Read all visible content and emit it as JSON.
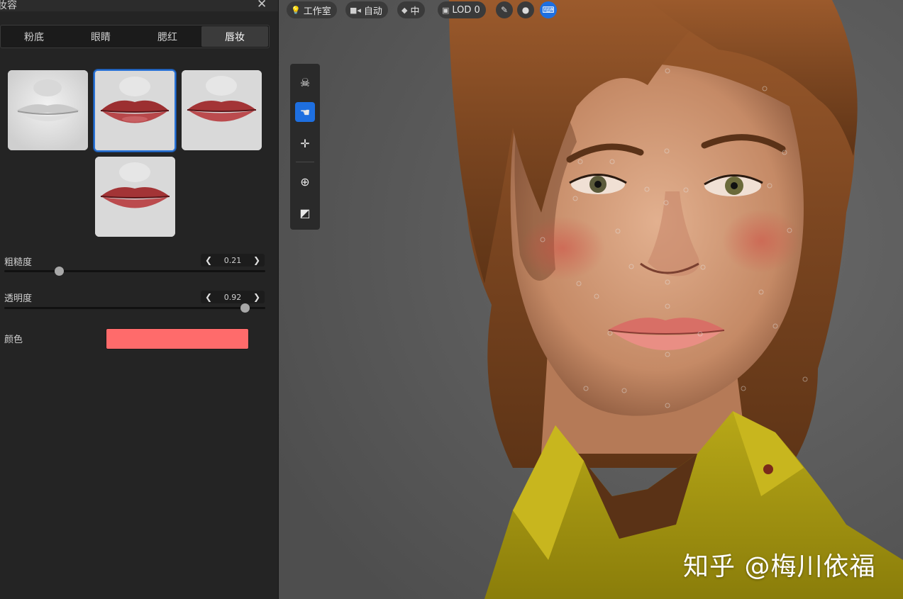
{
  "panel": {
    "title": "妆容",
    "close_icon": "close-icon",
    "tabs": [
      {
        "label": "粉底",
        "active": false
      },
      {
        "label": "眼睛",
        "active": false
      },
      {
        "label": "腮红",
        "active": false
      },
      {
        "label": "唇妆",
        "active": true
      }
    ],
    "presets": [
      {
        "name": "none",
        "selected": false
      },
      {
        "name": "red-lips-1",
        "selected": true
      },
      {
        "name": "red-lips-2",
        "selected": false
      },
      {
        "name": "red-lips-3",
        "selected": false
      }
    ],
    "sliders": [
      {
        "label": "粗糙度",
        "value": "0.21",
        "fraction": 0.21
      },
      {
        "label": "透明度",
        "value": "0.92",
        "fraction": 0.92
      }
    ],
    "color": {
      "label": "颜色",
      "value": "#ff6b6b"
    }
  },
  "top_bar": {
    "studio": {
      "icon": "bulb-icon",
      "label": "工作室"
    },
    "camera": {
      "icon": "camera-icon",
      "label": "自动"
    },
    "quality": {
      "icon": "diamond-icon",
      "label": "中"
    },
    "lod": {
      "icon": "cube-icon",
      "label": "LOD 0"
    },
    "buttons": [
      "brush-icon",
      "head-icon",
      "keyboard-icon"
    ]
  },
  "toolbar": {
    "tools": [
      "skull-icon",
      "select-hand-icon",
      "move-icon",
      "pivot-icon",
      "layers-icon"
    ],
    "active_tool": "select-hand-icon"
  },
  "watermark": "知乎 @梅川依福",
  "colors": {
    "accent": "#1e6fe0",
    "panel_bg": "#242424",
    "lip_red": "#a8383a",
    "shirt": "#a89a10"
  }
}
